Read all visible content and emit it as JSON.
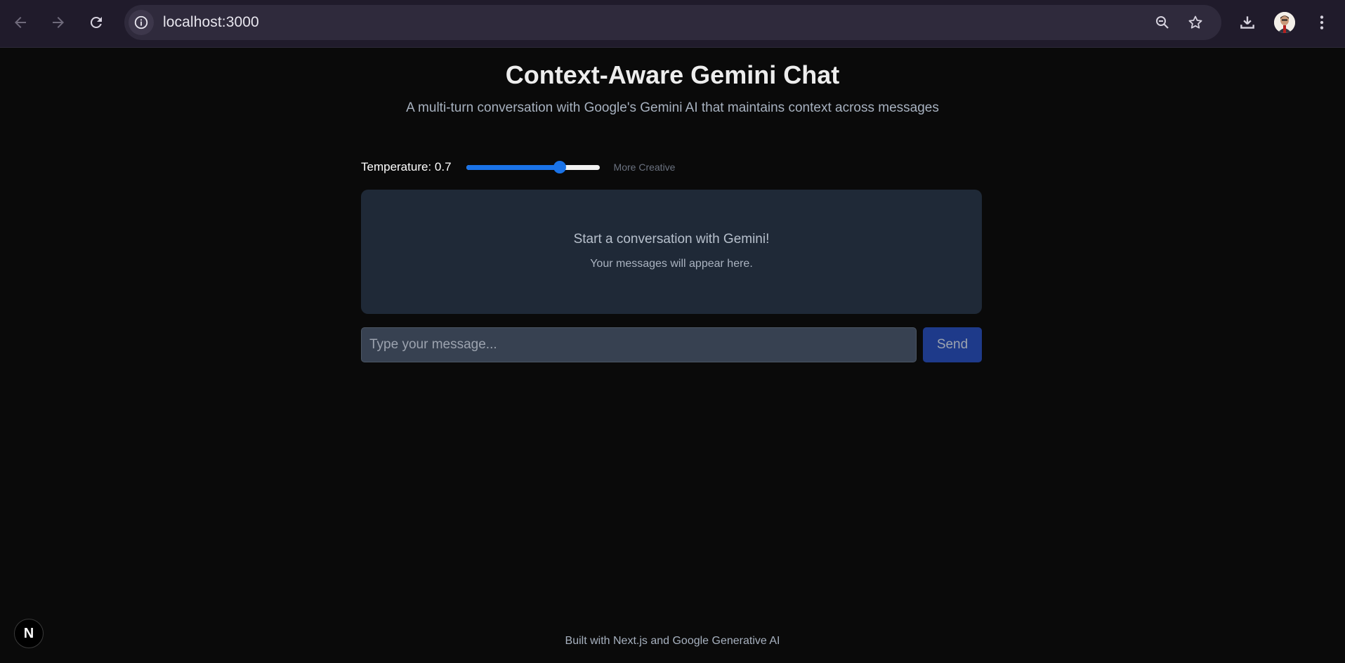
{
  "browser": {
    "url": "localhost:3000",
    "icons": [
      "back-icon",
      "forward-icon",
      "reload-icon",
      "site-info-icon",
      "zoom-icon",
      "bookmark-star-icon",
      "download-icon",
      "avatar",
      "menu-kebab-icon"
    ]
  },
  "page": {
    "title": "Context-Aware Gemini Chat",
    "subtitle": "A multi-turn conversation with Google's Gemini AI that maintains context across messages"
  },
  "temperature": {
    "label": "Temperature:",
    "value": "0.7",
    "level": 0.7,
    "hint": "More Creative"
  },
  "chat": {
    "empty_title": "Start a conversation with Gemini!",
    "empty_subtitle": "Your messages will appear here."
  },
  "composer": {
    "placeholder": "Type your message...",
    "value": "",
    "send_label": "Send"
  },
  "footer": {
    "text": "Built with Next.js and Google Generative AI"
  },
  "next_badge": {
    "letter": "N"
  },
  "colors": {
    "page_bg": "#0a0a0a",
    "chrome_bg": "#201b2b",
    "panel_bg": "#1f2937",
    "input_bg": "#374151",
    "accent": "#1a73e8",
    "send_bg": "#1e3a8a"
  }
}
